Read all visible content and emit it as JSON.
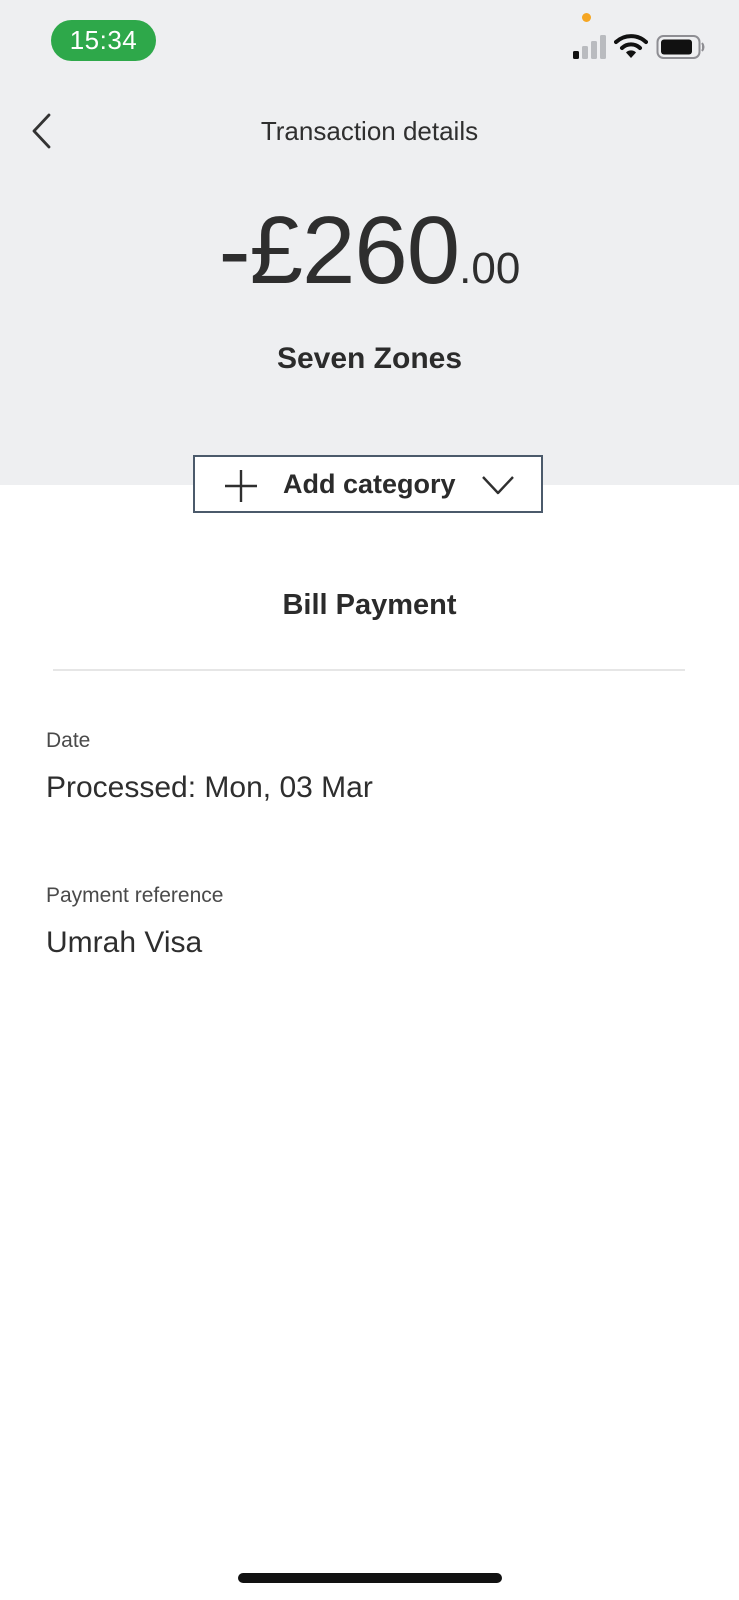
{
  "status_bar": {
    "time": "15:34"
  },
  "header": {
    "title": "Transaction details"
  },
  "transaction": {
    "amount_main": "-£260",
    "amount_decimal": ".00",
    "merchant": "Seven Zones",
    "type": "Bill Payment"
  },
  "category_button": {
    "label": "Add category"
  },
  "details": {
    "date_label": "Date",
    "date_value": "Processed: Mon, 03 Mar",
    "reference_label": "Payment reference",
    "reference_value": "Umrah Visa"
  },
  "icons": {
    "back": "chevron-left-icon",
    "add": "plus-icon",
    "dropdown": "chevron-down-icon",
    "signal": "cellular-signal-icon",
    "wifi": "wifi-icon",
    "battery": "battery-icon"
  },
  "colors": {
    "header_background": "#eeeff1",
    "time_pill": "#2ea84a",
    "privacy_dot": "#f5a623",
    "button_border": "#4b5a6b"
  }
}
